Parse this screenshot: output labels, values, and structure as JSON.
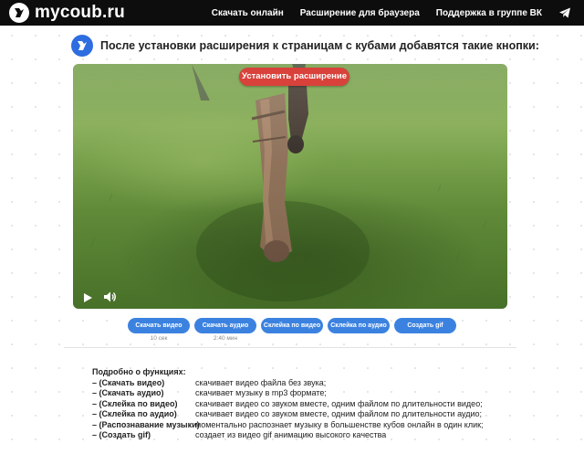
{
  "header": {
    "site_name": "mycoub.ru",
    "nav": [
      "Скачать онлайн",
      "Расширение для браузера",
      "Поддержка в группе ВК"
    ],
    "telegram_icon": "telegram-icon"
  },
  "intro": {
    "text": "После установки расширения к страницам с кубами добавятся такие кнопки:"
  },
  "video": {
    "install_label": "Установить расширение",
    "controls": [
      "play-icon",
      "volume-icon"
    ]
  },
  "buttons": [
    {
      "label": "Скачать видео",
      "sub": "10 сек"
    },
    {
      "label": "Скачать аудио",
      "sub": "2:40 мин"
    },
    {
      "label": "Склейка по видео",
      "sub": ""
    },
    {
      "label": "Склейка по аудио",
      "sub": ""
    },
    {
      "label": "Создать gif",
      "sub": ""
    }
  ],
  "features": {
    "title": "Подробно о функциях:",
    "items": [
      {
        "name": "– (Скачать видео)",
        "desc": "скачивает видео файла без звука;"
      },
      {
        "name": "– (Скачать аудио)",
        "desc": "скачивает музыку в mp3 формате;"
      },
      {
        "name": "– (Склейка по видео)",
        "desc": "скачивает видео со звуком вместе, одним файлом по длительности видео;"
      },
      {
        "name": "– (Склейка по аудио)",
        "desc": "скачивает видео со звуком вместе, одним файлом по длительности аудио;"
      },
      {
        "name": "– (Распознавание музыки)",
        "desc": "моментально распознает музыку в большенстве кубов онлайн в один клик;"
      },
      {
        "name": "– (Создать gif)",
        "desc": "создает из видео gif анимацию высокого качества"
      }
    ]
  },
  "colors": {
    "header_bg": "#0d0d0d",
    "accent_blue": "#3b82e0",
    "install_red": "#d8423b"
  }
}
